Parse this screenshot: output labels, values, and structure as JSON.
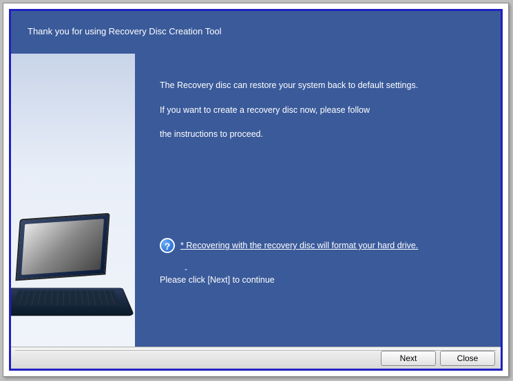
{
  "header": {
    "title": "Thank you for using Recovery Disc Creation Tool"
  },
  "body": {
    "line1": "The Recovery disc can restore your system back to default settings.",
    "line2": "If you want to create a recovery disc now, please follow",
    "line3": "the instructions to proceed.",
    "warning": "* Recovering with the recovery disc will format your hard drive.",
    "dash": "-",
    "continue": "Please click [Next] to continue"
  },
  "icons": {
    "help": "?"
  },
  "footer": {
    "next": "Next",
    "close": "Close"
  }
}
